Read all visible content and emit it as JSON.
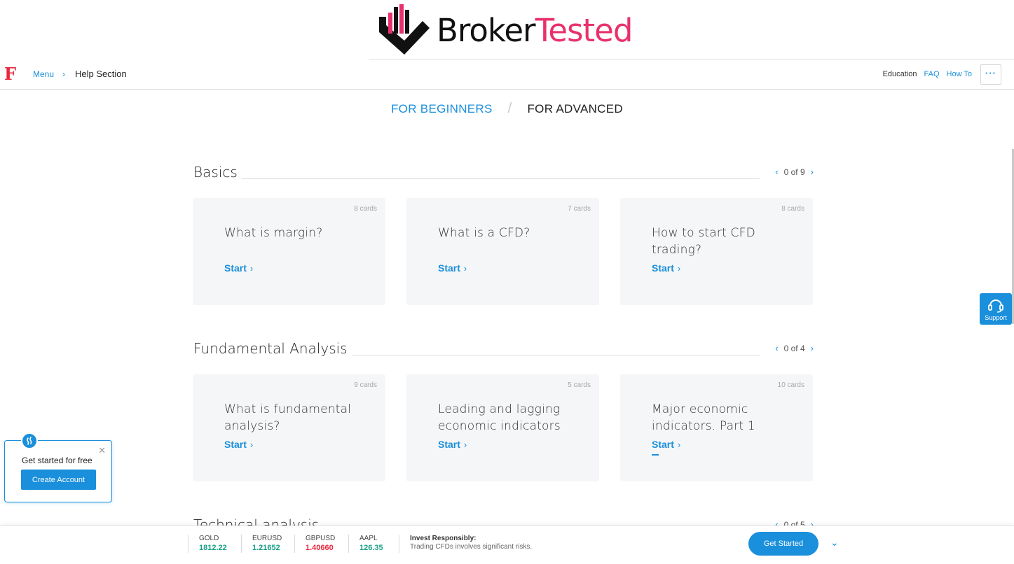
{
  "brand": {
    "part1": "Broker",
    "part2": "Tested"
  },
  "topnav": {
    "logo": "F",
    "menu": "Menu",
    "separator": "›",
    "current": "Help Section",
    "links": {
      "education": "Education",
      "faq": "FAQ",
      "howto": "How To"
    },
    "more": "···"
  },
  "levels": {
    "beginners": "FOR BEGINNERS",
    "slash": "/",
    "advanced": "FOR ADVANCED"
  },
  "sections": [
    {
      "title": "Basics",
      "pager": "0 of 9",
      "cards": [
        {
          "count": "8 cards",
          "title": "What is margin?",
          "start": "Start"
        },
        {
          "count": "7 cards",
          "title": "What is a CFD?",
          "start": "Start"
        },
        {
          "count": "8 cards",
          "title": "How to start CFD trading?",
          "start": "Start"
        }
      ]
    },
    {
      "title": "Fundamental Analysis",
      "pager": "0 of 4",
      "cards": [
        {
          "count": "9 cards",
          "title": "What is fundamental analysis?",
          "start": "Start"
        },
        {
          "count": "5 cards",
          "title": "Leading and lagging economic indicators",
          "start": "Start"
        },
        {
          "count": "10 cards",
          "title": "Major economic indicators. Part 1",
          "start": "Start"
        }
      ]
    },
    {
      "title": "Technical analysis",
      "pager": "0 of 5"
    }
  ],
  "pager_prev": "‹",
  "pager_next": "›",
  "start_chevron": "›",
  "support": {
    "label": "Support"
  },
  "popup": {
    "text": "Get started for free",
    "button": "Create Account",
    "close": "✕"
  },
  "ticker": {
    "items": [
      {
        "symbol": "GOLD",
        "price": "1812.22",
        "trend": "up"
      },
      {
        "symbol": "EURUSD",
        "price": "1.21652",
        "trend": "up"
      },
      {
        "symbol": "GBPUSD",
        "price": "1.40660",
        "trend": "down"
      },
      {
        "symbol": "AAPL",
        "price": "126.35",
        "trend": "up"
      }
    ],
    "invest_title": "Invest Responsibly:",
    "invest_text": "Trading CFDs involves significant risks.",
    "cta": "Get Started",
    "chevron": "⌄"
  },
  "colors": {
    "accent": "#1a8fdc",
    "brand_pink": "#e8316c",
    "up": "#16a085",
    "down": "#e8283f"
  }
}
